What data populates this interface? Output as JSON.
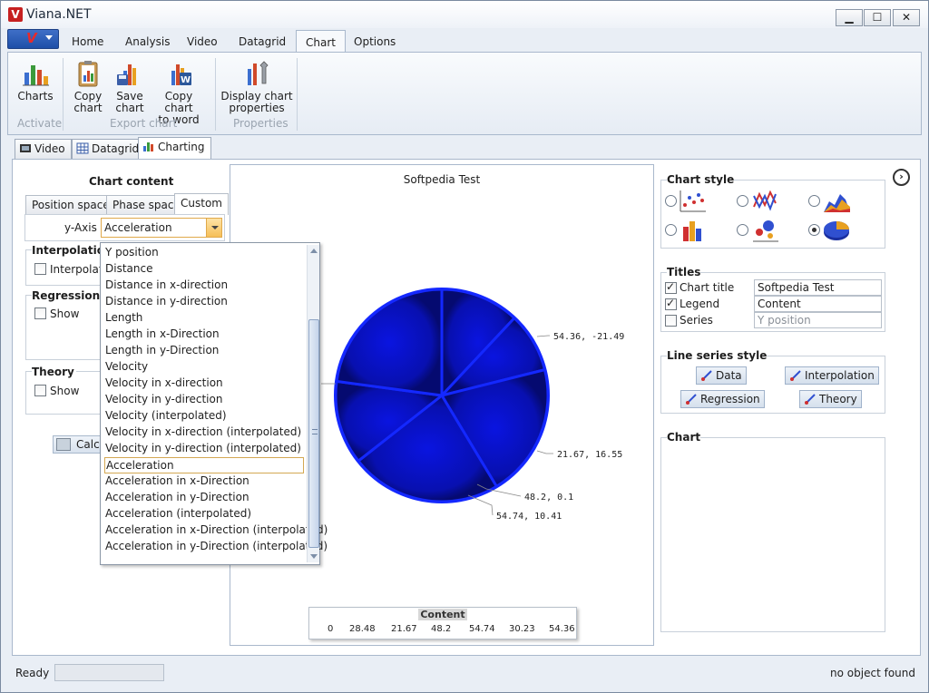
{
  "window": {
    "title": "Viana.NET",
    "minimize": "▁",
    "maximize": "☐",
    "close": "✕"
  },
  "ribbon_tabs": [
    "Home",
    "Analysis",
    "Video",
    "Datagrid",
    "Chart",
    "Options"
  ],
  "ribbon": {
    "charts_label": "Charts",
    "copy_chart_l1": "Copy",
    "copy_chart_l2": "chart",
    "save_chart_l1": "Save",
    "save_chart_l2": "chart",
    "copy_word_l1": "Copy chart",
    "copy_word_l2": "to word",
    "display_props_l1": "Display chart",
    "display_props_l2": "properties",
    "group_activate": "Activate",
    "group_export": "Export chart",
    "group_properties": "Properties"
  },
  "doc_tabs": [
    "Video",
    "Datagrid",
    "Charting"
  ],
  "left": {
    "chart_content_title": "Chart content",
    "space_tabs": [
      "Position space",
      "Phase space",
      "Custom"
    ],
    "yaxis_label": "y-Axis",
    "yaxis_value": "Acceleration",
    "interpolation_title": "Interpolation",
    "interpolation_cb": "Interpolati",
    "regression_title": "Regressionti",
    "regression_cb": "Show",
    "theory_title": "Theory",
    "theory_cb": "Show",
    "calc_label": "Calcu"
  },
  "dropdown": {
    "items": [
      "Y position",
      "Distance",
      "Distance in x-direction",
      "Distance in y-direction",
      "Length",
      "Length in x-Direction",
      "Length in y-Direction",
      "Velocity",
      "Velocity in x-direction",
      "Velocity in y-direction",
      "Velocity (interpolated)",
      "Velocity in x-direction (interpolated)",
      "Velocity in y-direction (interpolated)",
      "Acceleration",
      "Acceleration in x-Direction",
      "Acceleration in y-Direction",
      "Acceleration (interpolated)",
      "Acceleration in x-Direction (interpolated)",
      "Acceleration in y-Direction (interpolated)"
    ],
    "selected_index": 13
  },
  "chart_data": {
    "type": "pie",
    "title": "Softpedia Test",
    "legend_title": "Content",
    "values": [
      0,
      28.48,
      21.67,
      48.2,
      54.74,
      30.23,
      54.36
    ],
    "labels": [
      "54.36, -21.49",
      "21.67, 16.55",
      "48.2, 0.1",
      "54.74, 10.41"
    ],
    "color": "#0a10c8"
  },
  "right": {
    "chart_style_title": "Chart style",
    "titles_title": "Titles",
    "chart_title_label": "Chart title",
    "chart_title_value": "Softpedia Test",
    "legend_label": "Legend",
    "legend_value": "Content",
    "series_label": "Series",
    "series_placeholder": "Y position",
    "line_series_title": "Line series style",
    "data_btn": "Data",
    "interp_btn": "Interpolation",
    "regression_btn": "Regression",
    "theory_btn": "Theory",
    "chart_section_title": "Chart"
  },
  "status": {
    "left": "Ready",
    "right": "no object found"
  }
}
